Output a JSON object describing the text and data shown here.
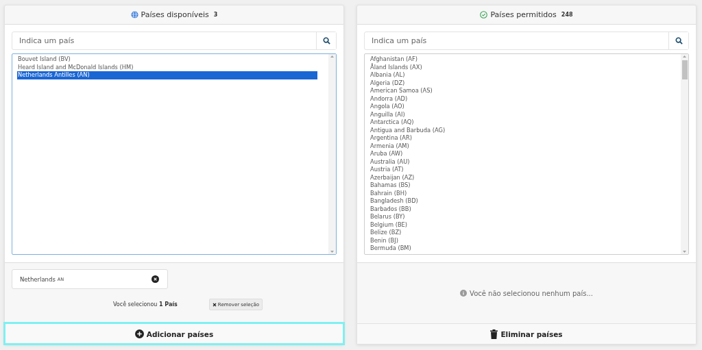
{
  "panels": [
    {
      "kind": "available",
      "title": "Países disponíveis",
      "count": "3",
      "search": {
        "placeholder": "Indica um país"
      },
      "items": [
        {
          "label": "Bouvet Island (BV)",
          "selected": false
        },
        {
          "label": "Heard Island and McDonald Islands (HM)",
          "selected": false
        },
        {
          "label": "Netherlands Antilles (AN)",
          "selected": true
        }
      ],
      "chips": [
        {
          "name": "Netherlands",
          "code": "AN"
        }
      ],
      "selection_summary": "Você selecionou **1 País**",
      "clear_button": "Remover seleção",
      "action": {
        "label": "Adicionar países",
        "focused": true
      }
    },
    {
      "kind": "allowed",
      "title": "Países permitidos",
      "count": "248",
      "search": {
        "placeholder": "Indica um país"
      },
      "items": [
        {
          "label": "Afghanistan (AF)",
          "selected": false
        },
        {
          "label": "Åland Islands (AX)",
          "selected": false
        },
        {
          "label": "Albania (AL)",
          "selected": false
        },
        {
          "label": "Algeria (DZ)",
          "selected": false
        },
        {
          "label": "American Samoa (AS)",
          "selected": false
        },
        {
          "label": "Andorra (AD)",
          "selected": false
        },
        {
          "label": "Angola (AO)",
          "selected": false
        },
        {
          "label": "Anguilla (AI)",
          "selected": false
        },
        {
          "label": "Antarctica (AQ)",
          "selected": false
        },
        {
          "label": "Antigua and Barbuda (AG)",
          "selected": false
        },
        {
          "label": "Argentina (AR)",
          "selected": false
        },
        {
          "label": "Armenia (AM)",
          "selected": false
        },
        {
          "label": "Aruba (AW)",
          "selected": false
        },
        {
          "label": "Australia (AU)",
          "selected": false
        },
        {
          "label": "Austria (AT)",
          "selected": false
        },
        {
          "label": "Azerbaijan (AZ)",
          "selected": false
        },
        {
          "label": "Bahamas (BS)",
          "selected": false
        },
        {
          "label": "Bahrain (BH)",
          "selected": false
        },
        {
          "label": "Bangladesh (BD)",
          "selected": false
        },
        {
          "label": "Barbados (BB)",
          "selected": false
        },
        {
          "label": "Belarus (BY)",
          "selected": false
        },
        {
          "label": "Belgium (BE)",
          "selected": false
        },
        {
          "label": "Belize (BZ)",
          "selected": false
        },
        {
          "label": "Benin (BJ)",
          "selected": false
        },
        {
          "label": "Bermuda (BM)",
          "selected": false
        }
      ],
      "empty_message": "Você não selecionou nenhum país...",
      "action": {
        "label": "Eliminar países",
        "focused": false
      }
    }
  ]
}
